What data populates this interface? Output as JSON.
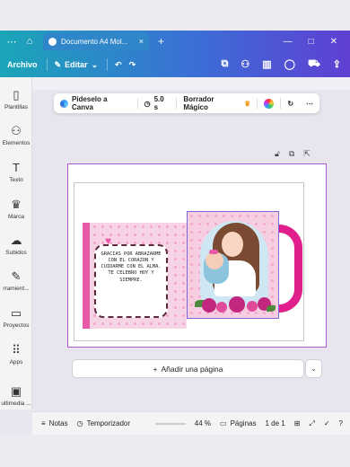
{
  "browser": {
    "tab_title": "Documento A4 Mol...",
    "tab_close": "×",
    "new_tab": "+",
    "window_controls": [
      "—",
      "□",
      "✕"
    ]
  },
  "toolbar": {
    "file_label": "Archivo",
    "edit_label": "Editar",
    "undo": "↶",
    "redo": "↷"
  },
  "sidebar": {
    "items": [
      {
        "label": "Plantillas",
        "icon": "▯"
      },
      {
        "label": "Elementos",
        "icon": "⚇"
      },
      {
        "label": "Texto",
        "icon": "T"
      },
      {
        "label": "Marca",
        "icon": "♛"
      },
      {
        "label": "Subidos",
        "icon": "☁"
      },
      {
        "label": "rramient...",
        "icon": "✎"
      },
      {
        "label": "Proyectos",
        "icon": "▭"
      },
      {
        "label": "Apps",
        "icon": "⠿"
      },
      {
        "label": "ultimedia ...",
        "icon": "▣"
      }
    ]
  },
  "floating_toolbar": {
    "canva_label": "Pídeselo a Canva",
    "duration": "5.0 s",
    "eraser_label": "Borrador Mágico",
    "eraser_badge": "♛"
  },
  "design": {
    "note_text": "GRACIAS POR ABRAZARME CON EL CORAZON Y CUIDARME CON EL ALMA. TE CELEBRO HOY Y SIEMPRE."
  },
  "actions": {
    "add_page": "Añadir una página",
    "add_page_icon": "+",
    "add_page_dropdown": "⌄"
  },
  "statusbar": {
    "notes": "Notas",
    "timer": "Temporizador",
    "zoom": "44 %",
    "pages_label": "Páginas",
    "page_counter": "1 de 1"
  },
  "colors": {
    "accent_gradient_start": "#1aa6b8",
    "accent_gradient_end": "#5f3fd3",
    "mug_handle": "#e01e8c",
    "page_border": "#b05bd6"
  }
}
